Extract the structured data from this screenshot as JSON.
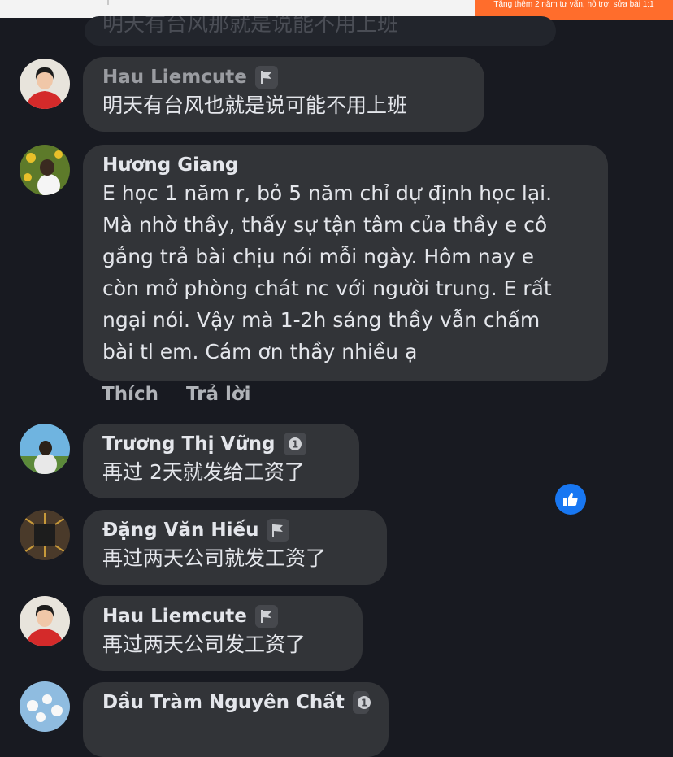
{
  "header": {
    "promo_text": "Tặng thêm 2 năm tư vấn, hỗ trợ, sửa bài 1:1"
  },
  "partial_comment": {
    "text": "明天有台风那就是说能不用上班"
  },
  "comments": [
    {
      "author": "Hau Liemcute",
      "badge": "flag-icon",
      "lines": [
        "明天有台风也就是说可能不用上班"
      ]
    },
    {
      "author": "Hương Giang",
      "badge": null,
      "lines": [
        "E học 1 năm r, bỏ 5 năm chỉ dự định học lại.",
        "Mà nhờ thầy, thấy sự tận tâm của thầy e cô",
        "gắng trả bài chịu nói mỗi ngày. Hôm nay e",
        "còn mở phòng chát nc với người trung. E rất",
        "ngại nói. Vậy mà 1-2h sáng thầy vẫn chấm",
        "bài tl em. Cám ơn thầy nhiều ạ"
      ],
      "actions": {
        "like": "Thích",
        "reply": "Trả lời"
      }
    },
    {
      "author": "Trương Thị Vững",
      "badge": "top-fan-1-icon",
      "lines": [
        "再过 2天就发给工资了"
      ]
    },
    {
      "author": "Đặng Văn Hiếu",
      "badge": "flag-icon",
      "lines": [
        "再过两天公司就发工资了"
      ]
    },
    {
      "author": "Hau Liemcute",
      "badge": "flag-icon",
      "lines": [
        "再过两天公司发工资了"
      ]
    },
    {
      "author": "Dầu Tràm Nguyên Chất",
      "badge": "top-fan-1-icon",
      "lines": []
    }
  ],
  "colors": {
    "background": "#181a21",
    "bubble": "#323438",
    "text": "#e4e6eb",
    "action_text": "#b0b3b8",
    "like_blue": "#1877f2",
    "promo_orange": "#ff6d2c"
  },
  "reaction": {
    "icon": "thumbs-up-icon"
  }
}
